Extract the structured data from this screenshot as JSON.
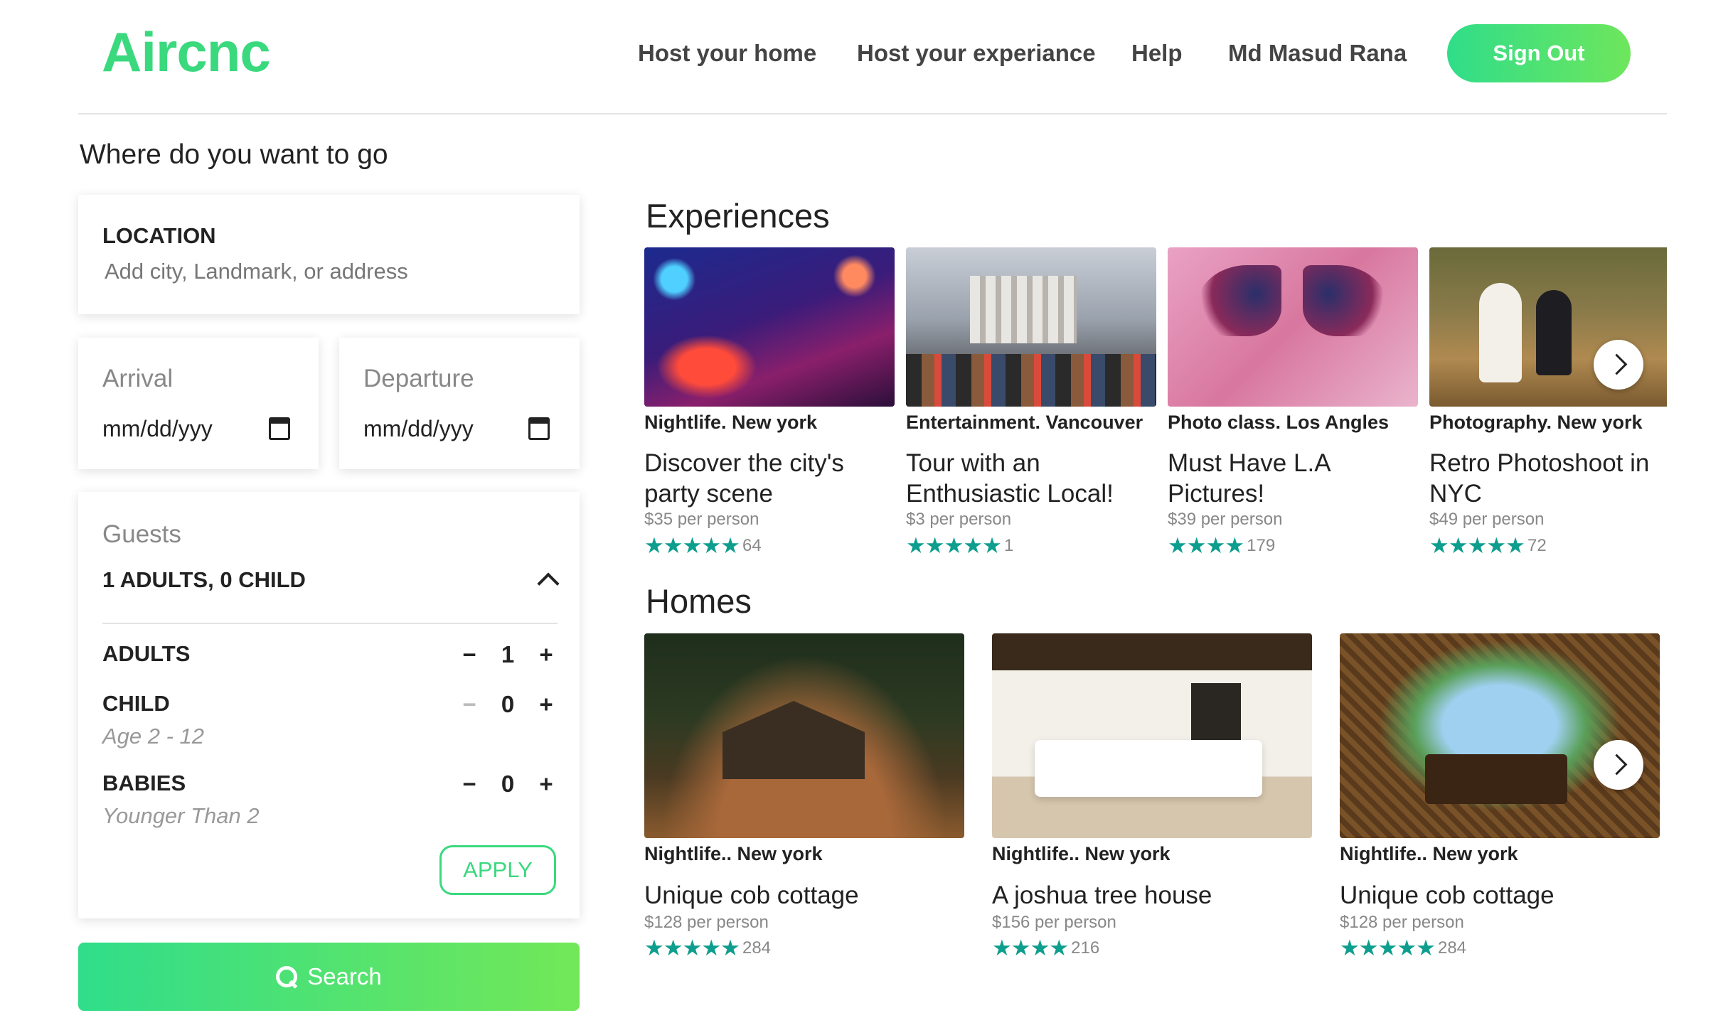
{
  "header": {
    "logo": "Aircnc",
    "nav": [
      "Host your home",
      "Host your experiance",
      "Help",
      "Md Masud Rana"
    ],
    "sign_out": "Sign Out",
    "accent_color": "#3ad97e"
  },
  "search_panel": {
    "heading": "Where do you want to go",
    "location_label": "LOCATION",
    "location_placeholder": "Add city, Landmark, or address",
    "arrival_label": "Arrival",
    "arrival_value": "mm/dd/yyy",
    "departure_label": "Departure",
    "departure_value": "mm/dd/yyy",
    "guests": {
      "title": "Guests",
      "summary": "1 ADULTS, 0 CHILD",
      "rows": [
        {
          "label": "ADULTS",
          "sub": "",
          "count": "1",
          "minus": "−",
          "plus": "+"
        },
        {
          "label": "CHILD",
          "sub": "Age 2 - 12",
          "count": "0",
          "minus": "−",
          "plus": "+"
        },
        {
          "label": "BABIES",
          "sub": "Younger Than 2",
          "count": "0",
          "minus": "−",
          "plus": "+"
        }
      ],
      "apply": "APPLY"
    },
    "search_button": "Search"
  },
  "experiences": {
    "title": "Experiences",
    "items": [
      {
        "tag": "Nightlife. New york",
        "title_lines": [
          "Discover the city's",
          "party scene"
        ],
        "price": "$35 per person",
        "stars": "★★★★★",
        "reviews": "64"
      },
      {
        "tag": "Entertainment. Vancouver",
        "title_lines": [
          "Tour with an",
          "Enthusiastic Local!"
        ],
        "price": "$3 per person",
        "stars": "★★★★★",
        "reviews": "1"
      },
      {
        "tag": "Photo class. Los Angles",
        "title_lines": [
          "Must Have L.A",
          "Pictures!"
        ],
        "price": "$39 per person",
        "stars": "★★★★",
        "reviews": "179"
      },
      {
        "tag": "Photography. New york",
        "title_lines": [
          "Retro Photoshoot in",
          "NYC"
        ],
        "price": "$49 per person",
        "stars": "★★★★★",
        "reviews": "72"
      }
    ]
  },
  "homes": {
    "title": "Homes",
    "items": [
      {
        "tag": "Nightlife.. New york",
        "title": "Unique cob cottage",
        "price": "$128 per person",
        "stars": "★★★★★",
        "reviews": "284"
      },
      {
        "tag": "Nightlife.. New york",
        "title": "A joshua tree house",
        "price": "$156 per person",
        "stars": "★★★★",
        "reviews": "216"
      },
      {
        "tag": "Nightlife.. New york",
        "title": "Unique cob cottage",
        "price": "$128 per person",
        "stars": "★★★★★",
        "reviews": "284"
      }
    ]
  }
}
